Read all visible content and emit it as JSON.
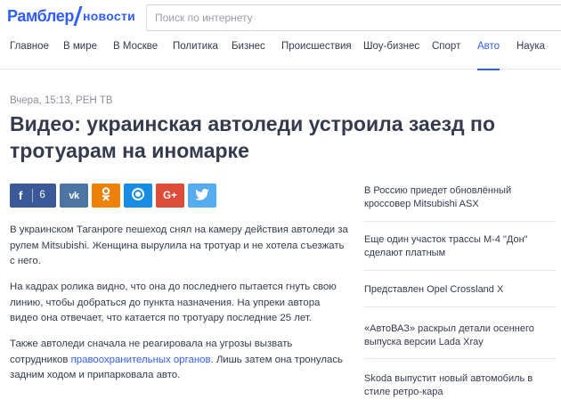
{
  "header": {
    "logo_main": "Рамблер",
    "logo_section": "новости",
    "search_placeholder": "Поиск по интернету"
  },
  "nav": {
    "items": [
      "Главное",
      "В мире",
      "В Москве",
      "Политика",
      "Бизнес",
      "Происшествия",
      "Шоу-бизнес",
      "Спорт",
      "Авто",
      "Наука"
    ],
    "active": "Авто"
  },
  "article": {
    "meta": "Вчера, 15:13, РЕН ТВ",
    "title": "Видео: украинская автоледи устроила заезд по тротуарам на иномарке",
    "share": {
      "facebook_count": "6",
      "vk_label": "vk",
      "ok_label": "ok",
      "mailru_label": "mail",
      "gplus_label": "G+",
      "twitter_label": "tw"
    },
    "paragraphs": [
      "В украинском Таганроге пешеход снял на камеру действия автоледи за рулем Mitsubishi. Женщина вырулила на тротуар и не хотела съезжать с него.",
      "На кадрах ролика видно, что она до последнего пытается гнуть свою линию, чтобы добраться до пункта назначения. На упреки автора видео она отвечает, что катается по тротуару последние 25 лет."
    ],
    "p3_before": "Также автоледи сначала не реагировала на угрозы вызвать сотрудников ",
    "p3_link": "правоохранительных органов",
    "p3_after": ". Лишь затем она тронулась задним ходом и припарковала авто."
  },
  "sidebar": {
    "items": [
      "В Россию приедет обновлённый кроссовер Mitsubishi ASX",
      "Еще один участок трассы М-4 \"Дон\" сделают платным",
      "Представлен Opel Crossland X",
      "«АвтоВАЗ» раскрыл детали осеннего выпуска версии Lada Xray",
      "Skoda выпустит новый автомобиль в стиле ретро-кара"
    ]
  },
  "colors": {
    "brand": "#315efb",
    "text": "#343b4c",
    "muted": "#8a8f9b",
    "facebook": "#3b5998",
    "vk": "#4c75a3",
    "ok": "#ee8208",
    "mailru": "#168de2",
    "gplus": "#dd4b39",
    "twitter": "#55acee"
  }
}
